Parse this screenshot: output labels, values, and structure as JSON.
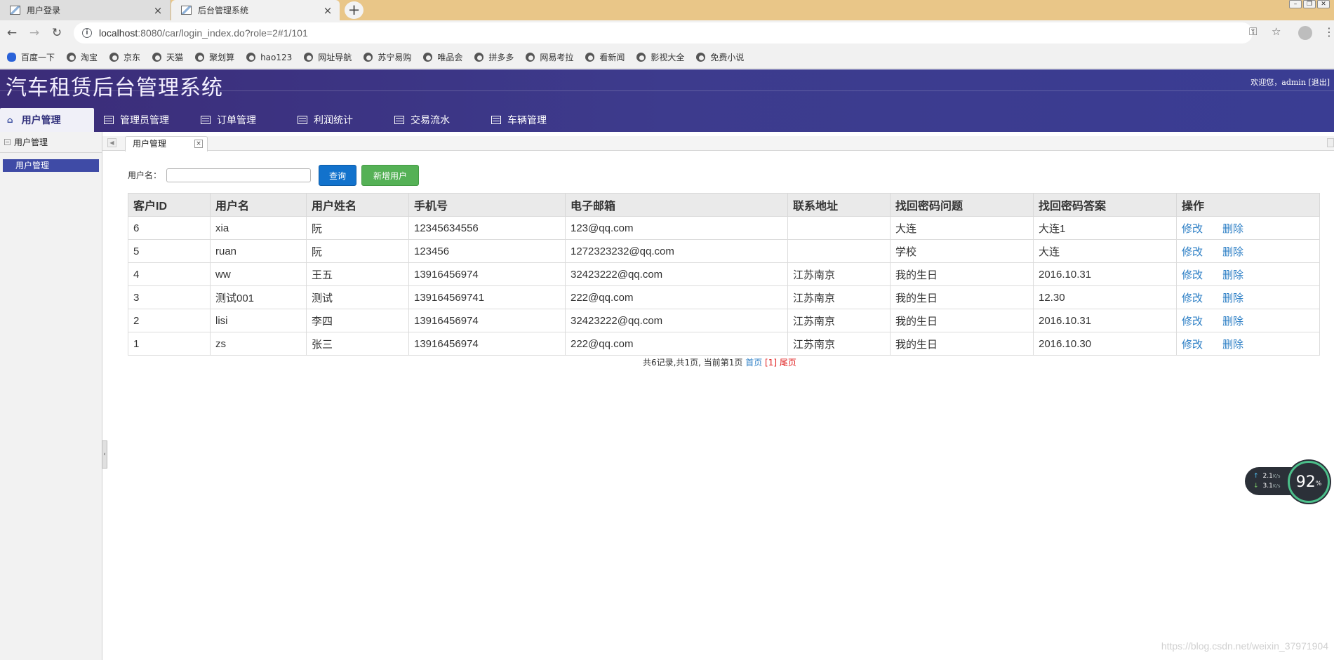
{
  "browser": {
    "tabs": [
      {
        "label": "用户登录",
        "active": false
      },
      {
        "label": "后台管理系统",
        "active": true
      }
    ],
    "new_tab": "+",
    "url_host": "localhost",
    "url_path": ":8080/car/login_index.do?role=2#1/101",
    "bookmarks": [
      "百度一下",
      "淘宝",
      "京东",
      "天猫",
      "聚划算",
      "hao123",
      "网址导航",
      "苏宁易购",
      "唯品会",
      "拼多多",
      "网易考拉",
      "看新闻",
      "影视大全",
      "免费小说"
    ]
  },
  "app": {
    "title": "汽车租赁后台管理系统",
    "welcome": "欢迎您，admin",
    "logout": "[退出]",
    "nav": [
      {
        "label": "用户管理",
        "active": true
      },
      {
        "label": "管理员管理",
        "active": false
      },
      {
        "label": "订单管理",
        "active": false
      },
      {
        "label": "利润统计",
        "active": false
      },
      {
        "label": "交易流水",
        "active": false
      },
      {
        "label": "车辆管理",
        "active": false
      }
    ]
  },
  "sidebar": {
    "section": "用户管理",
    "items": [
      {
        "label": "用户管理",
        "selected": true
      }
    ]
  },
  "content_tab": {
    "label": "用户管理",
    "close": "×"
  },
  "search": {
    "label": "用户名：",
    "value": "",
    "query_button": "查询",
    "add_button": "新增用户"
  },
  "table": {
    "columns": [
      "客户ID",
      "用户名",
      "用户姓名",
      "手机号",
      "电子邮箱",
      "联系地址",
      "找回密码问题",
      "找回密码答案",
      "操作"
    ],
    "edit_label": "修改",
    "delete_label": "删除",
    "rows": [
      [
        "6",
        "xia",
        "阮",
        "12345634556",
        "123@qq.com",
        "",
        "大连",
        "大连1"
      ],
      [
        "5",
        "ruan",
        "阮",
        "123456",
        "1272323232@qq.com",
        "",
        "学校",
        "大连"
      ],
      [
        "4",
        "ww",
        "王五",
        "13916456974",
        "32423222@qq.com",
        "江苏南京",
        "我的生日",
        "2016.10.31"
      ],
      [
        "3",
        "测试001",
        "测试",
        "139164569741",
        "222@qq.com",
        "江苏南京",
        "我的生日",
        "12.30"
      ],
      [
        "2",
        "lisi",
        "李四",
        "13916456974",
        "32423222@qq.com",
        "江苏南京",
        "我的生日",
        "2016.10.31"
      ],
      [
        "1",
        "zs",
        "张三",
        "13916456974",
        "222@qq.com",
        "江苏南京",
        "我的生日",
        "2016.10.30"
      ]
    ]
  },
  "pager": {
    "summary": "共6记录,共1页, 当前第1页",
    "first": "首页",
    "current": "[1]",
    "last": "尾页"
  },
  "speed_widget": {
    "up": "2.1",
    "down": "3.1",
    "unit": "K/s",
    "percent": "92",
    "percent_sign": "%"
  },
  "watermark": "https://blog.csdn.net/weixin_37971904"
}
